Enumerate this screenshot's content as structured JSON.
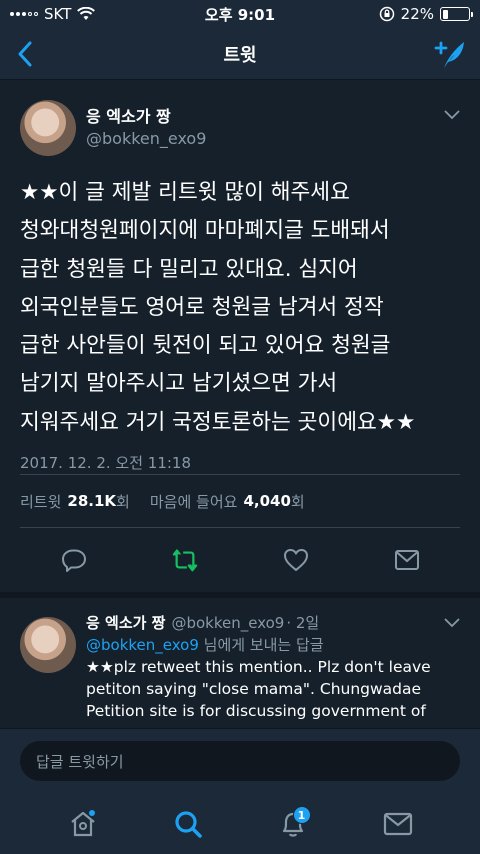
{
  "status_bar": {
    "carrier": "SKT",
    "time": "오후 9:01",
    "battery_percent": "22%",
    "battery_level": 0.22
  },
  "nav": {
    "title": "트윗"
  },
  "tweet": {
    "display_name": "응 엑소가 짱",
    "handle": "@bokken_exo9",
    "text": "★★이 글 제발 리트윗 많이 해주세요\n청와대청원페이지에 마마폐지글 도배돼서\n급한 청원들 다 밀리고 있대요. 심지어\n외국인분들도 영어로 청원글 남겨서 정작\n급한 사안들이 뒷전이 되고 있어요 청원글\n남기지 말아주시고 남기셨으면 가서\n지워주세요 거기 국정토론하는 곳이에요★★",
    "timestamp": "2017. 12. 2. 오전 11:18",
    "stats": {
      "retweets_label": "리트윗",
      "retweets_count": "28.1K",
      "retweets_suffix": "회",
      "likes_label": "마음에 들어요",
      "likes_count": "4,040",
      "likes_suffix": "회"
    }
  },
  "reply": {
    "display_name": "응 엑소가 짱",
    "handle": "@bokken_exo9",
    "age": "· 2일",
    "reply_to_handle": "@bokken_exo9",
    "reply_to_suffix": "님에게 보내는 답글",
    "text": "★★plz retweet this mention.. Plz don't leave petiton saying \"close mama\". Chungwadae Petition site is for discussing government of"
  },
  "reply_box": {
    "placeholder": "답글 트윗하기"
  },
  "tab_bar": {
    "notification_count": "1"
  },
  "colors": {
    "background": "#15202b",
    "bar": "#1c2938",
    "accent": "#1da1f2",
    "retweet_green": "#17bf63",
    "secondary_text": "#8899a6"
  }
}
